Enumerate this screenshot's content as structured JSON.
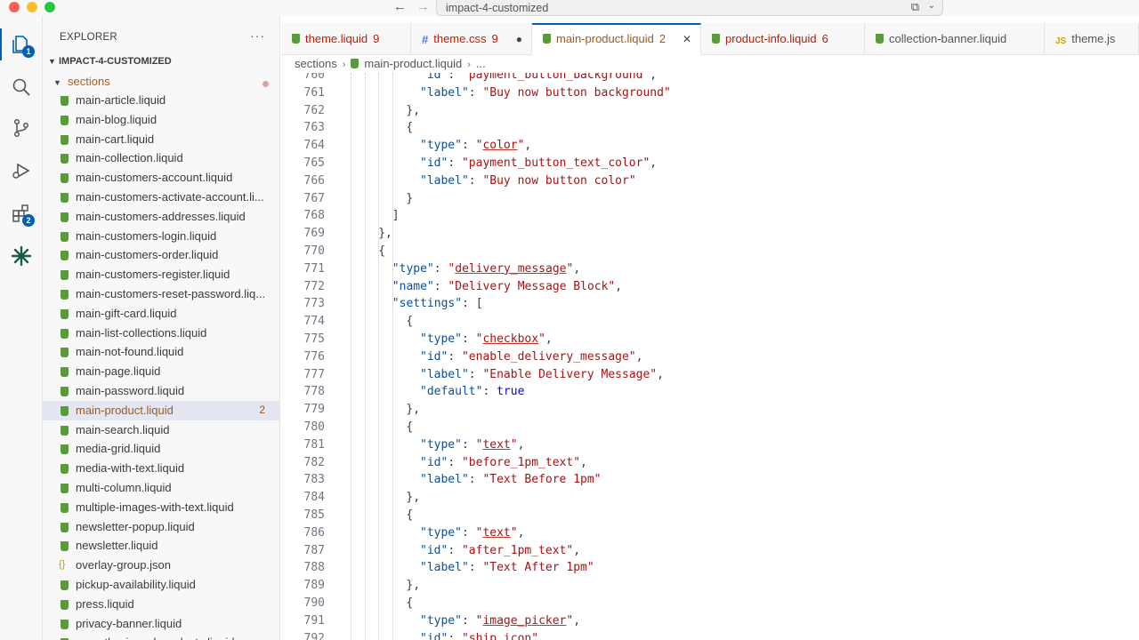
{
  "window": {
    "search_text": "impact-4-customized"
  },
  "activity": {
    "explorer_badge": "1",
    "extensions_badge": "2"
  },
  "sidebar": {
    "title": "EXPLORER",
    "more": "···",
    "project": "IMPACT-4-CUSTOMIZED",
    "folder": "sections",
    "files": [
      {
        "name": "main-article.liquid",
        "type": "liquid",
        "badge": "",
        "selected": false
      },
      {
        "name": "main-blog.liquid",
        "type": "liquid",
        "badge": "",
        "selected": false
      },
      {
        "name": "main-cart.liquid",
        "type": "liquid",
        "badge": "",
        "selected": false
      },
      {
        "name": "main-collection.liquid",
        "type": "liquid",
        "badge": "",
        "selected": false
      },
      {
        "name": "main-customers-account.liquid",
        "type": "liquid",
        "badge": "",
        "selected": false
      },
      {
        "name": "main-customers-activate-account.li...",
        "type": "liquid",
        "badge": "",
        "selected": false
      },
      {
        "name": "main-customers-addresses.liquid",
        "type": "liquid",
        "badge": "",
        "selected": false
      },
      {
        "name": "main-customers-login.liquid",
        "type": "liquid",
        "badge": "",
        "selected": false
      },
      {
        "name": "main-customers-order.liquid",
        "type": "liquid",
        "badge": "",
        "selected": false
      },
      {
        "name": "main-customers-register.liquid",
        "type": "liquid",
        "badge": "",
        "selected": false
      },
      {
        "name": "main-customers-reset-password.liq...",
        "type": "liquid",
        "badge": "",
        "selected": false
      },
      {
        "name": "main-gift-card.liquid",
        "type": "liquid",
        "badge": "",
        "selected": false
      },
      {
        "name": "main-list-collections.liquid",
        "type": "liquid",
        "badge": "",
        "selected": false
      },
      {
        "name": "main-not-found.liquid",
        "type": "liquid",
        "badge": "",
        "selected": false
      },
      {
        "name": "main-page.liquid",
        "type": "liquid",
        "badge": "",
        "selected": false
      },
      {
        "name": "main-password.liquid",
        "type": "liquid",
        "badge": "",
        "selected": false
      },
      {
        "name": "main-product.liquid",
        "type": "liquid",
        "badge": "2",
        "selected": true
      },
      {
        "name": "main-search.liquid",
        "type": "liquid",
        "badge": "",
        "selected": false
      },
      {
        "name": "media-grid.liquid",
        "type": "liquid",
        "badge": "",
        "selected": false
      },
      {
        "name": "media-with-text.liquid",
        "type": "liquid",
        "badge": "",
        "selected": false
      },
      {
        "name": "multi-column.liquid",
        "type": "liquid",
        "badge": "",
        "selected": false
      },
      {
        "name": "multiple-images-with-text.liquid",
        "type": "liquid",
        "badge": "",
        "selected": false
      },
      {
        "name": "newsletter-popup.liquid",
        "type": "liquid",
        "badge": "",
        "selected": false
      },
      {
        "name": "newsletter.liquid",
        "type": "liquid",
        "badge": "",
        "selected": false
      },
      {
        "name": "overlay-group.json",
        "type": "json",
        "badge": "",
        "selected": false
      },
      {
        "name": "pickup-availability.liquid",
        "type": "liquid",
        "badge": "",
        "selected": false
      },
      {
        "name": "press.liquid",
        "type": "liquid",
        "badge": "",
        "selected": false
      },
      {
        "name": "privacy-banner.liquid",
        "type": "liquid",
        "badge": "",
        "selected": false
      },
      {
        "name": "recently-viewed-products.liquid",
        "type": "liquid",
        "badge": "",
        "selected": false
      }
    ]
  },
  "tabs": [
    {
      "name": "theme.liquid",
      "icon": "liquid",
      "count": "9",
      "style": "err",
      "state": "",
      "active": false
    },
    {
      "name": "theme.css",
      "icon": "css",
      "count": "9",
      "style": "err",
      "state": "●",
      "active": false
    },
    {
      "name": "main-product.liquid",
      "icon": "liquid",
      "count": "2",
      "style": "mod",
      "state": "✕",
      "active": true
    },
    {
      "name": "product-info.liquid",
      "icon": "liquid",
      "count": "6",
      "style": "err",
      "state": "",
      "active": false
    },
    {
      "name": "collection-banner.liquid",
      "icon": "liquid",
      "count": "",
      "style": "plain",
      "state": "",
      "active": false
    },
    {
      "name": "theme.js",
      "icon": "js",
      "count": "",
      "style": "plain",
      "state": "",
      "active": false
    }
  ],
  "breadcrumb": {
    "folder": "sections",
    "file": "main-product.liquid",
    "more": "..."
  },
  "code": {
    "lines": [
      {
        "n": "760",
        "text": "\"id\": \"payment_button_background\","
      },
      {
        "n": "761",
        "text": "\"label\": \"Buy now button background\""
      },
      {
        "n": "762",
        "text": "},"
      },
      {
        "n": "763",
        "text": "{"
      },
      {
        "n": "764",
        "text": "\"type\": \"color\","
      },
      {
        "n": "765",
        "text": "\"id\": \"payment_button_text_color\","
      },
      {
        "n": "766",
        "text": "\"label\": \"Buy now button color\""
      },
      {
        "n": "767",
        "text": "}"
      },
      {
        "n": "768",
        "text": "]"
      },
      {
        "n": "769",
        "text": "},"
      },
      {
        "n": "770",
        "text": "{"
      },
      {
        "n": "771",
        "text": "\"type\": \"delivery_message\","
      },
      {
        "n": "772",
        "text": "\"name\": \"Delivery Message Block\","
      },
      {
        "n": "773",
        "text": "\"settings\": ["
      },
      {
        "n": "774",
        "text": "{"
      },
      {
        "n": "775",
        "text": "\"type\": \"checkbox\","
      },
      {
        "n": "776",
        "text": "\"id\": \"enable_delivery_message\","
      },
      {
        "n": "777",
        "text": "\"label\": \"Enable Delivery Message\","
      },
      {
        "n": "778",
        "text": "\"default\": true"
      },
      {
        "n": "779",
        "text": "},"
      },
      {
        "n": "780",
        "text": "{"
      },
      {
        "n": "781",
        "text": "\"type\": \"text\","
      },
      {
        "n": "782",
        "text": "\"id\": \"before_1pm_text\","
      },
      {
        "n": "783",
        "text": "\"label\": \"Text Before 1pm\""
      },
      {
        "n": "784",
        "text": "},"
      },
      {
        "n": "785",
        "text": "{"
      },
      {
        "n": "786",
        "text": "\"type\": \"text\","
      },
      {
        "n": "787",
        "text": "\"id\": \"after_1pm_text\","
      },
      {
        "n": "788",
        "text": "\"label\": \"Text After 1pm\""
      },
      {
        "n": "789",
        "text": "},"
      },
      {
        "n": "790",
        "text": "{"
      },
      {
        "n": "791",
        "text": "\"type\": \"image_picker\","
      },
      {
        "n": "792",
        "text": "\"id\": \"ship_icon\","
      }
    ]
  },
  "colors": {
    "accent": "#005fb8",
    "error": "#b5200d",
    "modified": "#9c5b1e",
    "liquid_icon": "#5a9a3c"
  },
  "icons": [
    "explorer-icon",
    "search-icon",
    "source-control-icon",
    "run-debug-icon",
    "extensions-icon",
    "ai-sparkle-icon"
  ]
}
